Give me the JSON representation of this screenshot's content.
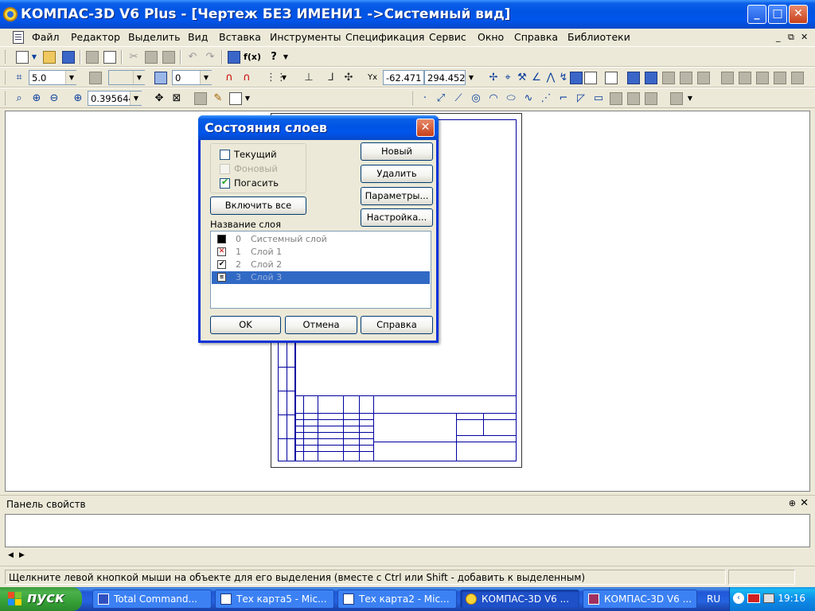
{
  "window": {
    "title": "КОМПАС-3D V6 Plus - [Чертеж БЕЗ ИМЕНИ1 ->Системный вид]",
    "min_glyph": "_",
    "max_glyph": "□",
    "close_glyph": "✕"
  },
  "menu": {
    "items": [
      {
        "label": "Файл"
      },
      {
        "label": "Редактор"
      },
      {
        "label": "Выделить"
      },
      {
        "label": "Вид"
      },
      {
        "label": "Вставка"
      },
      {
        "label": "Инструменты"
      },
      {
        "label": "Спецификация"
      },
      {
        "label": "Сервис"
      },
      {
        "label": "Окно"
      },
      {
        "label": "Справка"
      },
      {
        "label": "Библиотеки"
      }
    ],
    "mdi_min": "_",
    "mdi_restore": "⧉",
    "mdi_close": "✕"
  },
  "toolbar2": {
    "step_value": "5.0",
    "layer_value": "0",
    "coord_x": "-62.471",
    "coord_y": "294.452"
  },
  "toolbar3": {
    "zoom_value": "0.395644"
  },
  "dialog": {
    "title": "Состояния слоев",
    "close_glyph": "✕",
    "checks": [
      {
        "label": "Текущий",
        "checked": false,
        "disabled": false
      },
      {
        "label": "Фоновый",
        "checked": false,
        "disabled": true
      },
      {
        "label": "Погасить",
        "checked": true,
        "disabled": false
      }
    ],
    "check_mark": "✔",
    "enable_all_label": "Включить все",
    "buttons": {
      "new": "Новый",
      "delete": "Удалить",
      "params": "Параметры...",
      "settings": "Настройка..."
    },
    "list_label": "Название слоя",
    "layers": [
      {
        "num": "0",
        "name": "Системный слой",
        "selected": false
      },
      {
        "num": "1",
        "name": "Слой 1",
        "selected": false
      },
      {
        "num": "2",
        "name": "Слой 2",
        "selected": false
      },
      {
        "num": "3",
        "name": "Слой 3",
        "selected": true
      }
    ],
    "ok": "OK",
    "cancel": "Отмена",
    "help": "Справка"
  },
  "props_panel": {
    "title": "Панель свойств",
    "pin": "⊕",
    "close": "✕"
  },
  "status": {
    "text": "Щелкните левой кнопкой мыши на объекте для его выделения (вместе с Ctrl или Shift - добавить к выделенным)"
  },
  "taskbar": {
    "start_label": "пуск",
    "tasks": [
      {
        "label": "Total Command..."
      },
      {
        "label": "Тех карта5 - Mic..."
      },
      {
        "label": "Тех карта2 - Mic..."
      },
      {
        "label": "КОМПАС-3D V6 ..."
      },
      {
        "label": "КОМПАС-3D V6 ..."
      }
    ],
    "lang": "RU",
    "time": "19:16"
  },
  "colors": {
    "xp_blue": "#0054e3",
    "selection": "#316ac5",
    "sheet_border": "#0000a0"
  }
}
